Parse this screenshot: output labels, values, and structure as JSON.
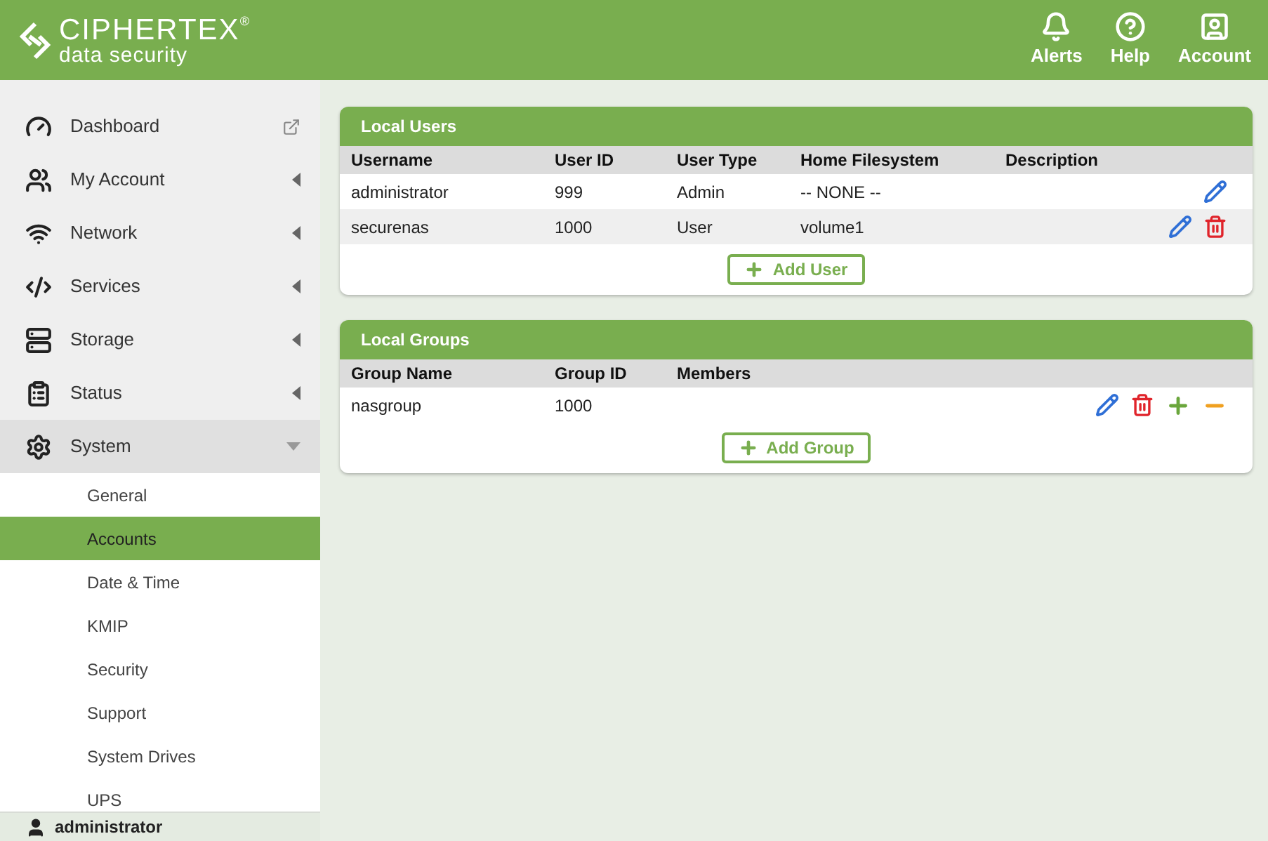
{
  "header": {
    "logo": {
      "name": "CIPHERTEX",
      "mark": "®",
      "tagline": "data security"
    },
    "actions": [
      {
        "label": "Alerts"
      },
      {
        "label": "Help"
      },
      {
        "label": "Account"
      }
    ]
  },
  "sidebar": {
    "items": [
      {
        "label": "Dashboard",
        "kind": "link"
      },
      {
        "label": "My Account",
        "kind": "menu",
        "expanded": false
      },
      {
        "label": "Network",
        "kind": "menu",
        "expanded": false
      },
      {
        "label": "Services",
        "kind": "menu",
        "expanded": false
      },
      {
        "label": "Storage",
        "kind": "menu",
        "expanded": false
      },
      {
        "label": "Status",
        "kind": "menu",
        "expanded": false
      },
      {
        "label": "System",
        "kind": "menu",
        "expanded": true,
        "children": [
          {
            "label": "General",
            "selected": false
          },
          {
            "label": "Accounts",
            "selected": true
          },
          {
            "label": "Date & Time",
            "selected": false
          },
          {
            "label": "KMIP",
            "selected": false
          },
          {
            "label": "Security",
            "selected": false
          },
          {
            "label": "Support",
            "selected": false
          },
          {
            "label": "System Drives",
            "selected": false
          },
          {
            "label": "UPS",
            "selected": false
          }
        ]
      }
    ],
    "user": "administrator"
  },
  "panels": [
    {
      "title": "Local Users",
      "columns": [
        "Username",
        "User ID",
        "User Type",
        "Home Filesystem",
        "Description"
      ],
      "rows": [
        {
          "cells": [
            "administrator",
            "999",
            "Admin",
            "-- NONE --"
          ],
          "actions": [
            {
              "kind": "edit"
            }
          ]
        },
        {
          "cells": [
            "securenas",
            "1000",
            "User",
            "volume1"
          ],
          "actions": [
            {
              "kind": "edit"
            },
            {
              "kind": "delete"
            }
          ]
        }
      ],
      "button": "Add User"
    },
    {
      "title": "Local Groups",
      "columns": [
        "Group Name",
        "Group ID",
        "Members"
      ],
      "rows": [
        {
          "cells": [
            "nasgroup",
            "1000"
          ],
          "actions": [
            {
              "kind": "edit"
            },
            {
              "kind": "delete"
            },
            {
              "kind": "add"
            },
            {
              "kind": "remove"
            }
          ]
        }
      ],
      "button": "Add Group"
    }
  ]
}
